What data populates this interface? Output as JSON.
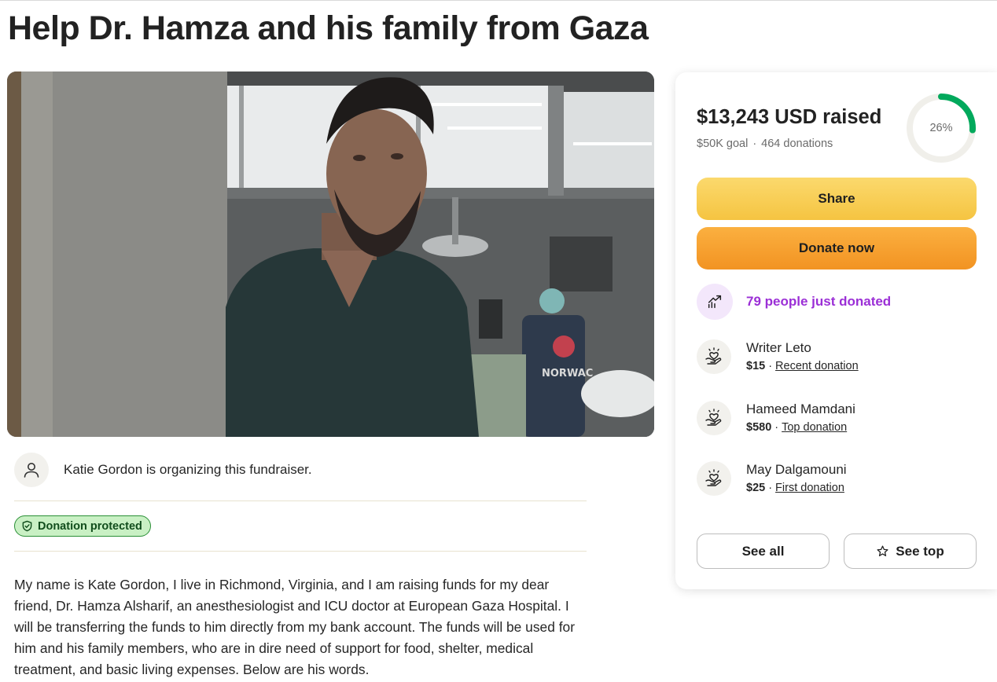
{
  "page": {
    "title": "Help Dr. Hamza and his family from Gaza"
  },
  "hero": {
    "scrubs_print": "NORWAC"
  },
  "organizer": {
    "text": "Katie Gordon is organizing this fundraiser."
  },
  "badge": {
    "label": "Donation protected"
  },
  "story": {
    "text": "My name is Kate Gordon, I live in Richmond, Virginia, and I am raising funds for my dear friend, Dr. Hamza Alsharif, an anesthesiologist and ICU doctor at European Gaza Hospital. I will be transferring the funds to him directly from my bank account. The funds will be used for him and his family members, who are in dire need of support for food, shelter, medical treatment, and basic living expenses. Below are his words."
  },
  "sidebar": {
    "raised": "$13,243 USD raised",
    "goal": "$50K goal",
    "separator": "·",
    "donations": "464 donations",
    "progress_label": "26%",
    "progress_fraction": 0.26,
    "share_label": "Share",
    "donate_label": "Donate now",
    "recent_activity": "79 people just donated",
    "donors": [
      {
        "name": "Writer Leto",
        "amount": "$15",
        "sep": "·",
        "tag": "Recent donation"
      },
      {
        "name": "Hameed Mamdani",
        "amount": "$580",
        "sep": "·",
        "tag": "Top donation"
      },
      {
        "name": "May Dalgamouni",
        "amount": "$25",
        "sep": "·",
        "tag": "First donation"
      }
    ],
    "see_all_label": "See all",
    "see_top_label": "See top"
  },
  "colors": {
    "progress_track": "#f0efea",
    "progress_fill": "#02a95c",
    "share_button": "#f9d15a",
    "donate_button": "#f5a030",
    "activity_text": "#9b2fd6",
    "badge_bg": "#c9f0c4",
    "badge_border": "#2a8f36"
  },
  "icons": {
    "organizer": "user-icon",
    "badge": "shield-check-icon",
    "activity": "trending-up-icon",
    "donor": "heart-hand-icon",
    "see_top": "star-icon"
  }
}
